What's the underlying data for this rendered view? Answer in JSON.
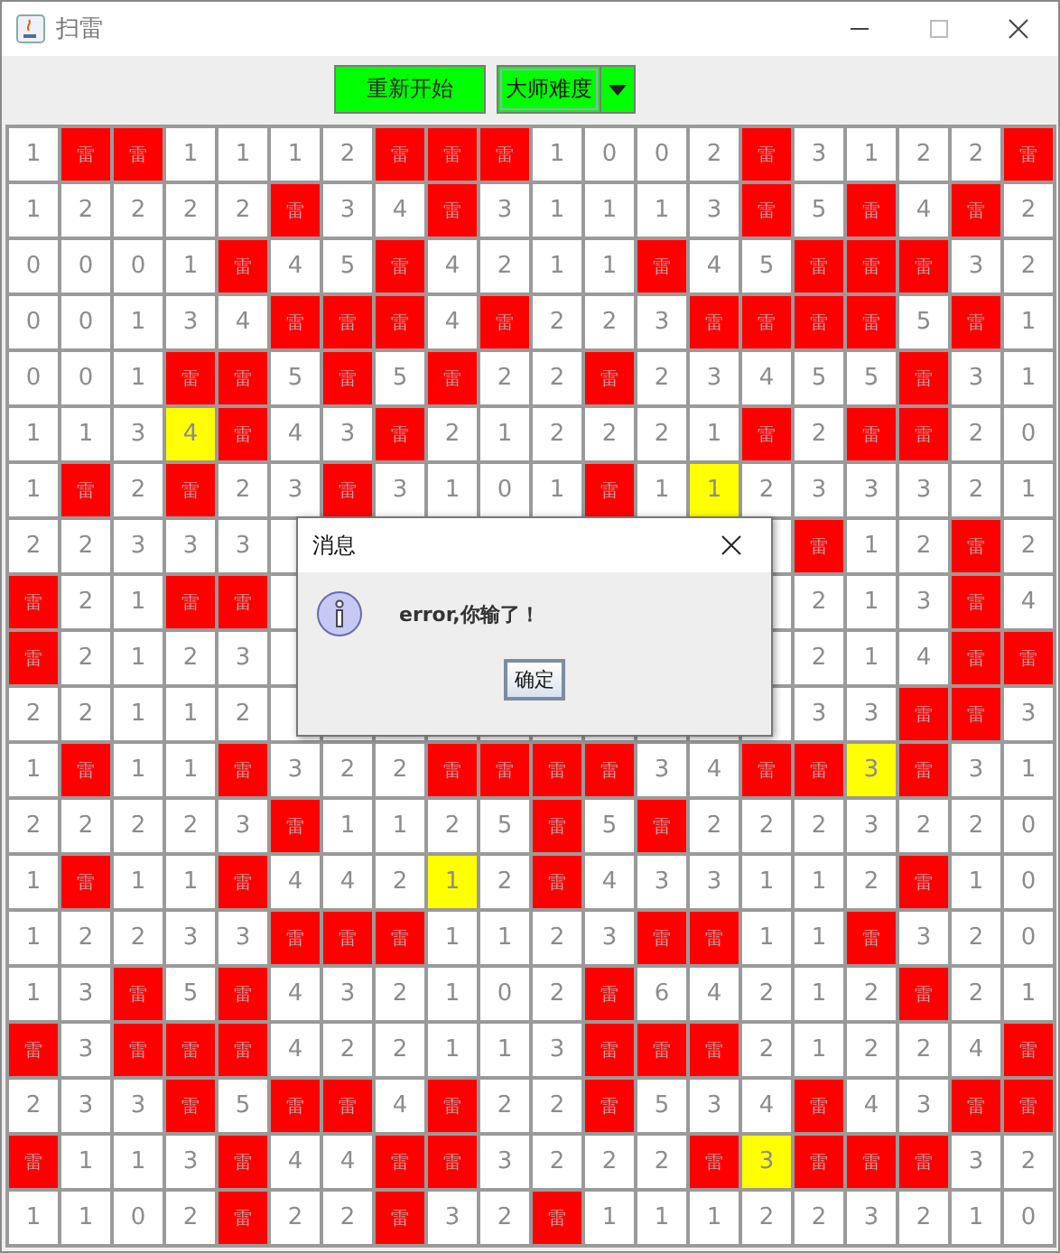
{
  "window": {
    "title": "扫雷"
  },
  "toolbar": {
    "restart_button": "重新开始",
    "difficulty": "大师难度"
  },
  "board": {
    "rows": [
      [
        {
          "text": "1",
          "kind": "number"
        },
        {
          "text": "雷",
          "kind": "mine"
        },
        {
          "text": "雷",
          "kind": "mine"
        },
        {
          "text": "1",
          "kind": "number"
        },
        {
          "text": "1",
          "kind": "number"
        },
        {
          "text": "1",
          "kind": "number"
        },
        {
          "text": "2",
          "kind": "number"
        },
        {
          "text": "雷",
          "kind": "mine"
        },
        {
          "text": "雷",
          "kind": "mine"
        },
        {
          "text": "雷",
          "kind": "mine"
        },
        {
          "text": "1",
          "kind": "number"
        },
        {
          "text": "0",
          "kind": "number"
        },
        {
          "text": "0",
          "kind": "number"
        },
        {
          "text": "2",
          "kind": "number"
        },
        {
          "text": "雷",
          "kind": "mine"
        },
        {
          "text": "3",
          "kind": "number"
        },
        {
          "text": "1",
          "kind": "number"
        },
        {
          "text": "2",
          "kind": "number"
        },
        {
          "text": "2",
          "kind": "number"
        },
        {
          "text": "雷",
          "kind": "mine"
        }
      ],
      [
        {
          "text": "1",
          "kind": "number"
        },
        {
          "text": "2",
          "kind": "number"
        },
        {
          "text": "2",
          "kind": "number"
        },
        {
          "text": "2",
          "kind": "number"
        },
        {
          "text": "2",
          "kind": "number"
        },
        {
          "text": "雷",
          "kind": "mine"
        },
        {
          "text": "3",
          "kind": "number"
        },
        {
          "text": "4",
          "kind": "number"
        },
        {
          "text": "雷",
          "kind": "mine"
        },
        {
          "text": "3",
          "kind": "number"
        },
        {
          "text": "1",
          "kind": "number"
        },
        {
          "text": "1",
          "kind": "number"
        },
        {
          "text": "1",
          "kind": "number"
        },
        {
          "text": "3",
          "kind": "number"
        },
        {
          "text": "雷",
          "kind": "mine"
        },
        {
          "text": "5",
          "kind": "number"
        },
        {
          "text": "雷",
          "kind": "mine"
        },
        {
          "text": "4",
          "kind": "number"
        },
        {
          "text": "雷",
          "kind": "mine"
        },
        {
          "text": "2",
          "kind": "number"
        }
      ],
      [
        {
          "text": "0",
          "kind": "number"
        },
        {
          "text": "0",
          "kind": "number"
        },
        {
          "text": "0",
          "kind": "number"
        },
        {
          "text": "1",
          "kind": "number"
        },
        {
          "text": "雷",
          "kind": "mine"
        },
        {
          "text": "4",
          "kind": "number"
        },
        {
          "text": "5",
          "kind": "number"
        },
        {
          "text": "雷",
          "kind": "mine"
        },
        {
          "text": "4",
          "kind": "number"
        },
        {
          "text": "2",
          "kind": "number"
        },
        {
          "text": "1",
          "kind": "number"
        },
        {
          "text": "1",
          "kind": "number"
        },
        {
          "text": "雷",
          "kind": "mine"
        },
        {
          "text": "4",
          "kind": "number"
        },
        {
          "text": "5",
          "kind": "number"
        },
        {
          "text": "雷",
          "kind": "mine"
        },
        {
          "text": "雷",
          "kind": "mine"
        },
        {
          "text": "雷",
          "kind": "mine"
        },
        {
          "text": "3",
          "kind": "number"
        },
        {
          "text": "2",
          "kind": "number"
        }
      ],
      [
        {
          "text": "0",
          "kind": "number"
        },
        {
          "text": "0",
          "kind": "number"
        },
        {
          "text": "1",
          "kind": "number"
        },
        {
          "text": "3",
          "kind": "number"
        },
        {
          "text": "4",
          "kind": "number"
        },
        {
          "text": "雷",
          "kind": "mine"
        },
        {
          "text": "雷",
          "kind": "mine"
        },
        {
          "text": "雷",
          "kind": "mine"
        },
        {
          "text": "4",
          "kind": "number"
        },
        {
          "text": "雷",
          "kind": "mine"
        },
        {
          "text": "2",
          "kind": "number"
        },
        {
          "text": "2",
          "kind": "number"
        },
        {
          "text": "3",
          "kind": "number"
        },
        {
          "text": "雷",
          "kind": "mine"
        },
        {
          "text": "雷",
          "kind": "mine"
        },
        {
          "text": "雷",
          "kind": "mine"
        },
        {
          "text": "雷",
          "kind": "mine"
        },
        {
          "text": "5",
          "kind": "number"
        },
        {
          "text": "雷",
          "kind": "mine"
        },
        {
          "text": "1",
          "kind": "number"
        }
      ],
      [
        {
          "text": "0",
          "kind": "number"
        },
        {
          "text": "0",
          "kind": "number"
        },
        {
          "text": "1",
          "kind": "number"
        },
        {
          "text": "雷",
          "kind": "mine"
        },
        {
          "text": "雷",
          "kind": "mine"
        },
        {
          "text": "5",
          "kind": "number"
        },
        {
          "text": "雷",
          "kind": "mine"
        },
        {
          "text": "5",
          "kind": "number"
        },
        {
          "text": "雷",
          "kind": "mine"
        },
        {
          "text": "2",
          "kind": "number"
        },
        {
          "text": "2",
          "kind": "number"
        },
        {
          "text": "雷",
          "kind": "mine"
        },
        {
          "text": "2",
          "kind": "number"
        },
        {
          "text": "3",
          "kind": "number"
        },
        {
          "text": "4",
          "kind": "number"
        },
        {
          "text": "5",
          "kind": "number"
        },
        {
          "text": "5",
          "kind": "number"
        },
        {
          "text": "雷",
          "kind": "mine"
        },
        {
          "text": "3",
          "kind": "number"
        },
        {
          "text": "1",
          "kind": "number"
        }
      ],
      [
        {
          "text": "1",
          "kind": "number"
        },
        {
          "text": "1",
          "kind": "number"
        },
        {
          "text": "3",
          "kind": "number"
        },
        {
          "text": "4",
          "kind": "highlight"
        },
        {
          "text": "雷",
          "kind": "mine"
        },
        {
          "text": "4",
          "kind": "number"
        },
        {
          "text": "3",
          "kind": "number"
        },
        {
          "text": "雷",
          "kind": "mine"
        },
        {
          "text": "2",
          "kind": "number"
        },
        {
          "text": "1",
          "kind": "number"
        },
        {
          "text": "2",
          "kind": "number"
        },
        {
          "text": "2",
          "kind": "number"
        },
        {
          "text": "2",
          "kind": "number"
        },
        {
          "text": "1",
          "kind": "number"
        },
        {
          "text": "雷",
          "kind": "mine"
        },
        {
          "text": "2",
          "kind": "number"
        },
        {
          "text": "雷",
          "kind": "mine"
        },
        {
          "text": "雷",
          "kind": "mine"
        },
        {
          "text": "2",
          "kind": "number"
        },
        {
          "text": "0",
          "kind": "number"
        }
      ],
      [
        {
          "text": "1",
          "kind": "number"
        },
        {
          "text": "雷",
          "kind": "mine"
        },
        {
          "text": "2",
          "kind": "number"
        },
        {
          "text": "雷",
          "kind": "mine"
        },
        {
          "text": "2",
          "kind": "number"
        },
        {
          "text": "3",
          "kind": "number"
        },
        {
          "text": "雷",
          "kind": "mine"
        },
        {
          "text": "3",
          "kind": "number"
        },
        {
          "text": "1",
          "kind": "number"
        },
        {
          "text": "0",
          "kind": "number"
        },
        {
          "text": "1",
          "kind": "number"
        },
        {
          "text": "雷",
          "kind": "mine"
        },
        {
          "text": "1",
          "kind": "number"
        },
        {
          "text": "1",
          "kind": "highlight"
        },
        {
          "text": "2",
          "kind": "number"
        },
        {
          "text": "3",
          "kind": "number"
        },
        {
          "text": "3",
          "kind": "number"
        },
        {
          "text": "3",
          "kind": "number"
        },
        {
          "text": "2",
          "kind": "number"
        },
        {
          "text": "1",
          "kind": "number"
        }
      ],
      [
        {
          "text": "2",
          "kind": "number"
        },
        {
          "text": "2",
          "kind": "number"
        },
        {
          "text": "3",
          "kind": "number"
        },
        {
          "text": "3",
          "kind": "number"
        },
        {
          "text": "3",
          "kind": "number"
        },
        null,
        null,
        null,
        null,
        null,
        null,
        null,
        null,
        null,
        null,
        {
          "text": "雷",
          "kind": "mine"
        },
        {
          "text": "1",
          "kind": "number"
        },
        {
          "text": "2",
          "kind": "number"
        },
        {
          "text": "雷",
          "kind": "mine"
        },
        {
          "text": "2",
          "kind": "number"
        }
      ],
      [
        {
          "text": "雷",
          "kind": "mine"
        },
        {
          "text": "2",
          "kind": "number"
        },
        {
          "text": "1",
          "kind": "number"
        },
        {
          "text": "雷",
          "kind": "mine"
        },
        {
          "text": "雷",
          "kind": "mine"
        },
        null,
        null,
        null,
        null,
        null,
        null,
        null,
        null,
        null,
        null,
        {
          "text": "2",
          "kind": "number"
        },
        {
          "text": "1",
          "kind": "number"
        },
        {
          "text": "3",
          "kind": "number"
        },
        {
          "text": "雷",
          "kind": "mine"
        },
        {
          "text": "4",
          "kind": "number"
        }
      ],
      [
        {
          "text": "雷",
          "kind": "mine"
        },
        {
          "text": "2",
          "kind": "number"
        },
        {
          "text": "1",
          "kind": "number"
        },
        {
          "text": "2",
          "kind": "number"
        },
        {
          "text": "3",
          "kind": "number"
        },
        null,
        null,
        null,
        null,
        null,
        null,
        null,
        null,
        null,
        null,
        {
          "text": "2",
          "kind": "number"
        },
        {
          "text": "1",
          "kind": "number"
        },
        {
          "text": "4",
          "kind": "number"
        },
        {
          "text": "雷",
          "kind": "mine"
        },
        {
          "text": "雷",
          "kind": "mine"
        }
      ],
      [
        {
          "text": "2",
          "kind": "number"
        },
        {
          "text": "2",
          "kind": "number"
        },
        {
          "text": "1",
          "kind": "number"
        },
        {
          "text": "1",
          "kind": "number"
        },
        {
          "text": "2",
          "kind": "number"
        },
        null,
        null,
        null,
        null,
        null,
        null,
        null,
        null,
        null,
        null,
        {
          "text": "3",
          "kind": "number"
        },
        {
          "text": "3",
          "kind": "number"
        },
        {
          "text": "雷",
          "kind": "mine"
        },
        {
          "text": "雷",
          "kind": "mine"
        },
        {
          "text": "3",
          "kind": "number"
        }
      ],
      [
        {
          "text": "1",
          "kind": "number"
        },
        {
          "text": "雷",
          "kind": "mine"
        },
        {
          "text": "1",
          "kind": "number"
        },
        {
          "text": "1",
          "kind": "number"
        },
        {
          "text": "雷",
          "kind": "mine"
        },
        {
          "text": "3",
          "kind": "number"
        },
        {
          "text": "2",
          "kind": "number"
        },
        {
          "text": "2",
          "kind": "number"
        },
        {
          "text": "雷",
          "kind": "mine"
        },
        {
          "text": "雷",
          "kind": "mine"
        },
        {
          "text": "雷",
          "kind": "mine"
        },
        {
          "text": "雷",
          "kind": "mine"
        },
        {
          "text": "3",
          "kind": "number"
        },
        {
          "text": "4",
          "kind": "number"
        },
        {
          "text": "雷",
          "kind": "mine"
        },
        {
          "text": "雷",
          "kind": "mine"
        },
        {
          "text": "3",
          "kind": "highlight"
        },
        {
          "text": "雷",
          "kind": "mine"
        },
        {
          "text": "3",
          "kind": "number"
        },
        {
          "text": "1",
          "kind": "number"
        }
      ],
      [
        {
          "text": "2",
          "kind": "number"
        },
        {
          "text": "2",
          "kind": "number"
        },
        {
          "text": "2",
          "kind": "number"
        },
        {
          "text": "2",
          "kind": "number"
        },
        {
          "text": "3",
          "kind": "number"
        },
        {
          "text": "雷",
          "kind": "mine"
        },
        {
          "text": "1",
          "kind": "number"
        },
        {
          "text": "1",
          "kind": "number"
        },
        {
          "text": "2",
          "kind": "number"
        },
        {
          "text": "5",
          "kind": "number"
        },
        {
          "text": "雷",
          "kind": "mine"
        },
        {
          "text": "5",
          "kind": "number"
        },
        {
          "text": "雷",
          "kind": "mine"
        },
        {
          "text": "2",
          "kind": "number"
        },
        {
          "text": "2",
          "kind": "number"
        },
        {
          "text": "2",
          "kind": "number"
        },
        {
          "text": "3",
          "kind": "number"
        },
        {
          "text": "2",
          "kind": "number"
        },
        {
          "text": "2",
          "kind": "number"
        },
        {
          "text": "0",
          "kind": "number"
        }
      ],
      [
        {
          "text": "1",
          "kind": "number"
        },
        {
          "text": "雷",
          "kind": "mine"
        },
        {
          "text": "1",
          "kind": "number"
        },
        {
          "text": "1",
          "kind": "number"
        },
        {
          "text": "雷",
          "kind": "mine"
        },
        {
          "text": "4",
          "kind": "number"
        },
        {
          "text": "4",
          "kind": "number"
        },
        {
          "text": "2",
          "kind": "number"
        },
        {
          "text": "1",
          "kind": "highlight"
        },
        {
          "text": "2",
          "kind": "number"
        },
        {
          "text": "雷",
          "kind": "mine"
        },
        {
          "text": "4",
          "kind": "number"
        },
        {
          "text": "3",
          "kind": "number"
        },
        {
          "text": "3",
          "kind": "number"
        },
        {
          "text": "1",
          "kind": "number"
        },
        {
          "text": "1",
          "kind": "number"
        },
        {
          "text": "2",
          "kind": "number"
        },
        {
          "text": "雷",
          "kind": "mine"
        },
        {
          "text": "1",
          "kind": "number"
        },
        {
          "text": "0",
          "kind": "number"
        }
      ],
      [
        {
          "text": "1",
          "kind": "number"
        },
        {
          "text": "2",
          "kind": "number"
        },
        {
          "text": "2",
          "kind": "number"
        },
        {
          "text": "3",
          "kind": "number"
        },
        {
          "text": "3",
          "kind": "number"
        },
        {
          "text": "雷",
          "kind": "mine"
        },
        {
          "text": "雷",
          "kind": "mine"
        },
        {
          "text": "雷",
          "kind": "mine"
        },
        {
          "text": "1",
          "kind": "number"
        },
        {
          "text": "1",
          "kind": "number"
        },
        {
          "text": "2",
          "kind": "number"
        },
        {
          "text": "3",
          "kind": "number"
        },
        {
          "text": "雷",
          "kind": "mine"
        },
        {
          "text": "雷",
          "kind": "mine"
        },
        {
          "text": "1",
          "kind": "number"
        },
        {
          "text": "1",
          "kind": "number"
        },
        {
          "text": "雷",
          "kind": "mine"
        },
        {
          "text": "3",
          "kind": "number"
        },
        {
          "text": "2",
          "kind": "number"
        },
        {
          "text": "0",
          "kind": "number"
        }
      ],
      [
        {
          "text": "1",
          "kind": "number"
        },
        {
          "text": "3",
          "kind": "number"
        },
        {
          "text": "雷",
          "kind": "mine"
        },
        {
          "text": "5",
          "kind": "number"
        },
        {
          "text": "雷",
          "kind": "mine"
        },
        {
          "text": "4",
          "kind": "number"
        },
        {
          "text": "3",
          "kind": "number"
        },
        {
          "text": "2",
          "kind": "number"
        },
        {
          "text": "1",
          "kind": "number"
        },
        {
          "text": "0",
          "kind": "number"
        },
        {
          "text": "2",
          "kind": "number"
        },
        {
          "text": "雷",
          "kind": "mine"
        },
        {
          "text": "6",
          "kind": "number"
        },
        {
          "text": "4",
          "kind": "number"
        },
        {
          "text": "2",
          "kind": "number"
        },
        {
          "text": "1",
          "kind": "number"
        },
        {
          "text": "2",
          "kind": "number"
        },
        {
          "text": "雷",
          "kind": "mine"
        },
        {
          "text": "2",
          "kind": "number"
        },
        {
          "text": "1",
          "kind": "number"
        }
      ],
      [
        {
          "text": "雷",
          "kind": "mine"
        },
        {
          "text": "3",
          "kind": "number"
        },
        {
          "text": "雷",
          "kind": "mine"
        },
        {
          "text": "雷",
          "kind": "mine"
        },
        {
          "text": "雷",
          "kind": "mine"
        },
        {
          "text": "4",
          "kind": "number"
        },
        {
          "text": "2",
          "kind": "number"
        },
        {
          "text": "2",
          "kind": "number"
        },
        {
          "text": "1",
          "kind": "number"
        },
        {
          "text": "1",
          "kind": "number"
        },
        {
          "text": "3",
          "kind": "number"
        },
        {
          "text": "雷",
          "kind": "mine"
        },
        {
          "text": "雷",
          "kind": "mine"
        },
        {
          "text": "雷",
          "kind": "mine"
        },
        {
          "text": "2",
          "kind": "number"
        },
        {
          "text": "1",
          "kind": "number"
        },
        {
          "text": "2",
          "kind": "number"
        },
        {
          "text": "2",
          "kind": "number"
        },
        {
          "text": "4",
          "kind": "number"
        },
        {
          "text": "雷",
          "kind": "mine"
        }
      ],
      [
        {
          "text": "2",
          "kind": "number"
        },
        {
          "text": "3",
          "kind": "number"
        },
        {
          "text": "3",
          "kind": "number"
        },
        {
          "text": "雷",
          "kind": "mine"
        },
        {
          "text": "5",
          "kind": "number"
        },
        {
          "text": "雷",
          "kind": "mine"
        },
        {
          "text": "雷",
          "kind": "mine"
        },
        {
          "text": "4",
          "kind": "number"
        },
        {
          "text": "雷",
          "kind": "mine"
        },
        {
          "text": "2",
          "kind": "number"
        },
        {
          "text": "2",
          "kind": "number"
        },
        {
          "text": "雷",
          "kind": "mine"
        },
        {
          "text": "5",
          "kind": "number"
        },
        {
          "text": "3",
          "kind": "number"
        },
        {
          "text": "4",
          "kind": "number"
        },
        {
          "text": "雷",
          "kind": "mine"
        },
        {
          "text": "4",
          "kind": "number"
        },
        {
          "text": "3",
          "kind": "number"
        },
        {
          "text": "雷",
          "kind": "mine"
        },
        {
          "text": "雷",
          "kind": "mine"
        }
      ],
      [
        {
          "text": "雷",
          "kind": "mine"
        },
        {
          "text": "1",
          "kind": "number"
        },
        {
          "text": "1",
          "kind": "number"
        },
        {
          "text": "3",
          "kind": "number"
        },
        {
          "text": "雷",
          "kind": "mine"
        },
        {
          "text": "4",
          "kind": "number"
        },
        {
          "text": "4",
          "kind": "number"
        },
        {
          "text": "雷",
          "kind": "mine"
        },
        {
          "text": "雷",
          "kind": "mine"
        },
        {
          "text": "3",
          "kind": "number"
        },
        {
          "text": "2",
          "kind": "number"
        },
        {
          "text": "2",
          "kind": "number"
        },
        {
          "text": "2",
          "kind": "number"
        },
        {
          "text": "雷",
          "kind": "mine"
        },
        {
          "text": "3",
          "kind": "highlight"
        },
        {
          "text": "雷",
          "kind": "mine"
        },
        {
          "text": "雷",
          "kind": "mine"
        },
        {
          "text": "雷",
          "kind": "mine"
        },
        {
          "text": "3",
          "kind": "number"
        },
        {
          "text": "2",
          "kind": "number"
        }
      ],
      [
        {
          "text": "1",
          "kind": "number"
        },
        {
          "text": "1",
          "kind": "number"
        },
        {
          "text": "0",
          "kind": "number"
        },
        {
          "text": "2",
          "kind": "number"
        },
        {
          "text": "雷",
          "kind": "mine"
        },
        {
          "text": "2",
          "kind": "number"
        },
        {
          "text": "2",
          "kind": "number"
        },
        {
          "text": "雷",
          "kind": "mine"
        },
        {
          "text": "3",
          "kind": "number"
        },
        {
          "text": "2",
          "kind": "number"
        },
        {
          "text": "雷",
          "kind": "mine"
        },
        {
          "text": "1",
          "kind": "number"
        },
        {
          "text": "1",
          "kind": "number"
        },
        {
          "text": "1",
          "kind": "number"
        },
        {
          "text": "2",
          "kind": "number"
        },
        {
          "text": "2",
          "kind": "number"
        },
        {
          "text": "3",
          "kind": "number"
        },
        {
          "text": "2",
          "kind": "number"
        },
        {
          "text": "1",
          "kind": "number"
        },
        {
          "text": "0",
          "kind": "number"
        }
      ]
    ]
  },
  "dialog": {
    "title": "消息",
    "message": "error,你输了！",
    "button": "确定"
  }
}
